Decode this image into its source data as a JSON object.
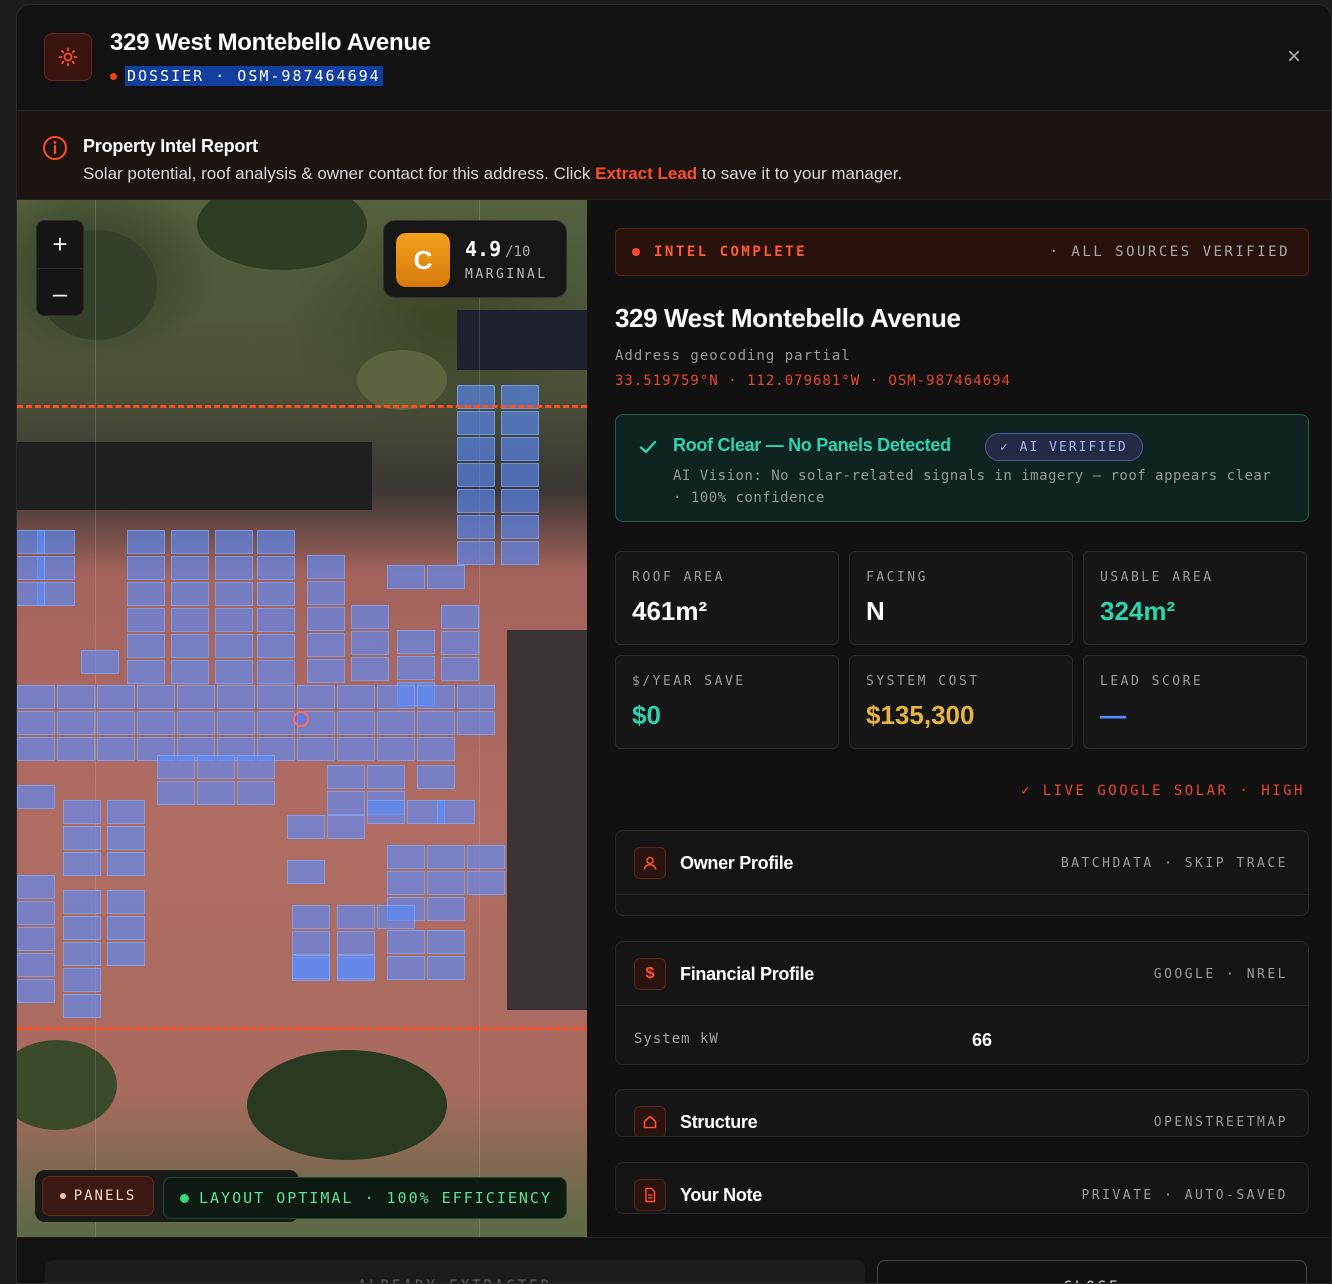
{
  "header": {
    "title": "329 West Montebello Avenue",
    "code": "DOSSIER · OSM-987464694",
    "close": "×"
  },
  "banner": {
    "title": "Property Intel Report",
    "text_before": "Solar potential, roof analysis & owner contact for this address. Click ",
    "highlight": "Extract Lead",
    "text_after": " to save it to your manager."
  },
  "map": {
    "zoom_in": "+",
    "zoom_out": "–",
    "grade": "C",
    "score": "4.9",
    "score_max": "/10",
    "score_label": "MARGINAL",
    "panels_button": "PANELS",
    "layout_status": "LAYOUT OPTIMAL · 100% EFFICIENCY"
  },
  "intel": {
    "status": "INTEL COMPLETE",
    "sources": "· ALL SOURCES VERIFIED"
  },
  "property": {
    "address": "329 West Montebello Avenue",
    "geocoding": "Address geocoding partial",
    "coords": "33.519759°N · 112.079681°W · OSM-987464694"
  },
  "roof_status": {
    "title": "Roof Clear — No Panels Detected",
    "badge": "✓ AI VERIFIED",
    "text": "AI Vision: No solar-related signals in imagery — roof appears clear · 100% confidence"
  },
  "stats": [
    {
      "label": "ROOF AREA",
      "value": "461m²",
      "color": "#ffffff"
    },
    {
      "label": "FACING",
      "value": "N",
      "color": "#ffffff"
    },
    {
      "label": "USABLE AREA",
      "value": "324m²",
      "color": "#2dd4b0"
    },
    {
      "label": "$/YEAR SAVE",
      "value": "$0",
      "color": "#2dd4b0"
    },
    {
      "label": "SYSTEM COST",
      "value": "$135,300",
      "color": "#e7b440"
    },
    {
      "label": "LEAD SCORE",
      "value": "—",
      "color": "#4f8cff"
    }
  ],
  "live_source": "✓ LIVE GOOGLE SOLAR · HIGH",
  "sections": {
    "owner": {
      "title": "Owner Profile",
      "source": "BATCHDATA · SKIP TRACE"
    },
    "financial": {
      "title": "Financial Profile",
      "source": "GOOGLE · NREL",
      "row_key": "System kW",
      "row_value": "66"
    },
    "structure": {
      "title": "Structure",
      "source": "OPENSTREETMAP"
    },
    "note": {
      "title": "Your Note",
      "source": "PRIVATE · AUTO-SAVED"
    }
  },
  "footer": {
    "extract_button": "ALREADY EXTRACTED",
    "close_button": "CLOSE"
  },
  "colors": {
    "accent": "#ff4d2b",
    "teal": "#2dd4b0",
    "gold": "#e7b440",
    "blue": "#4f8cff"
  }
}
